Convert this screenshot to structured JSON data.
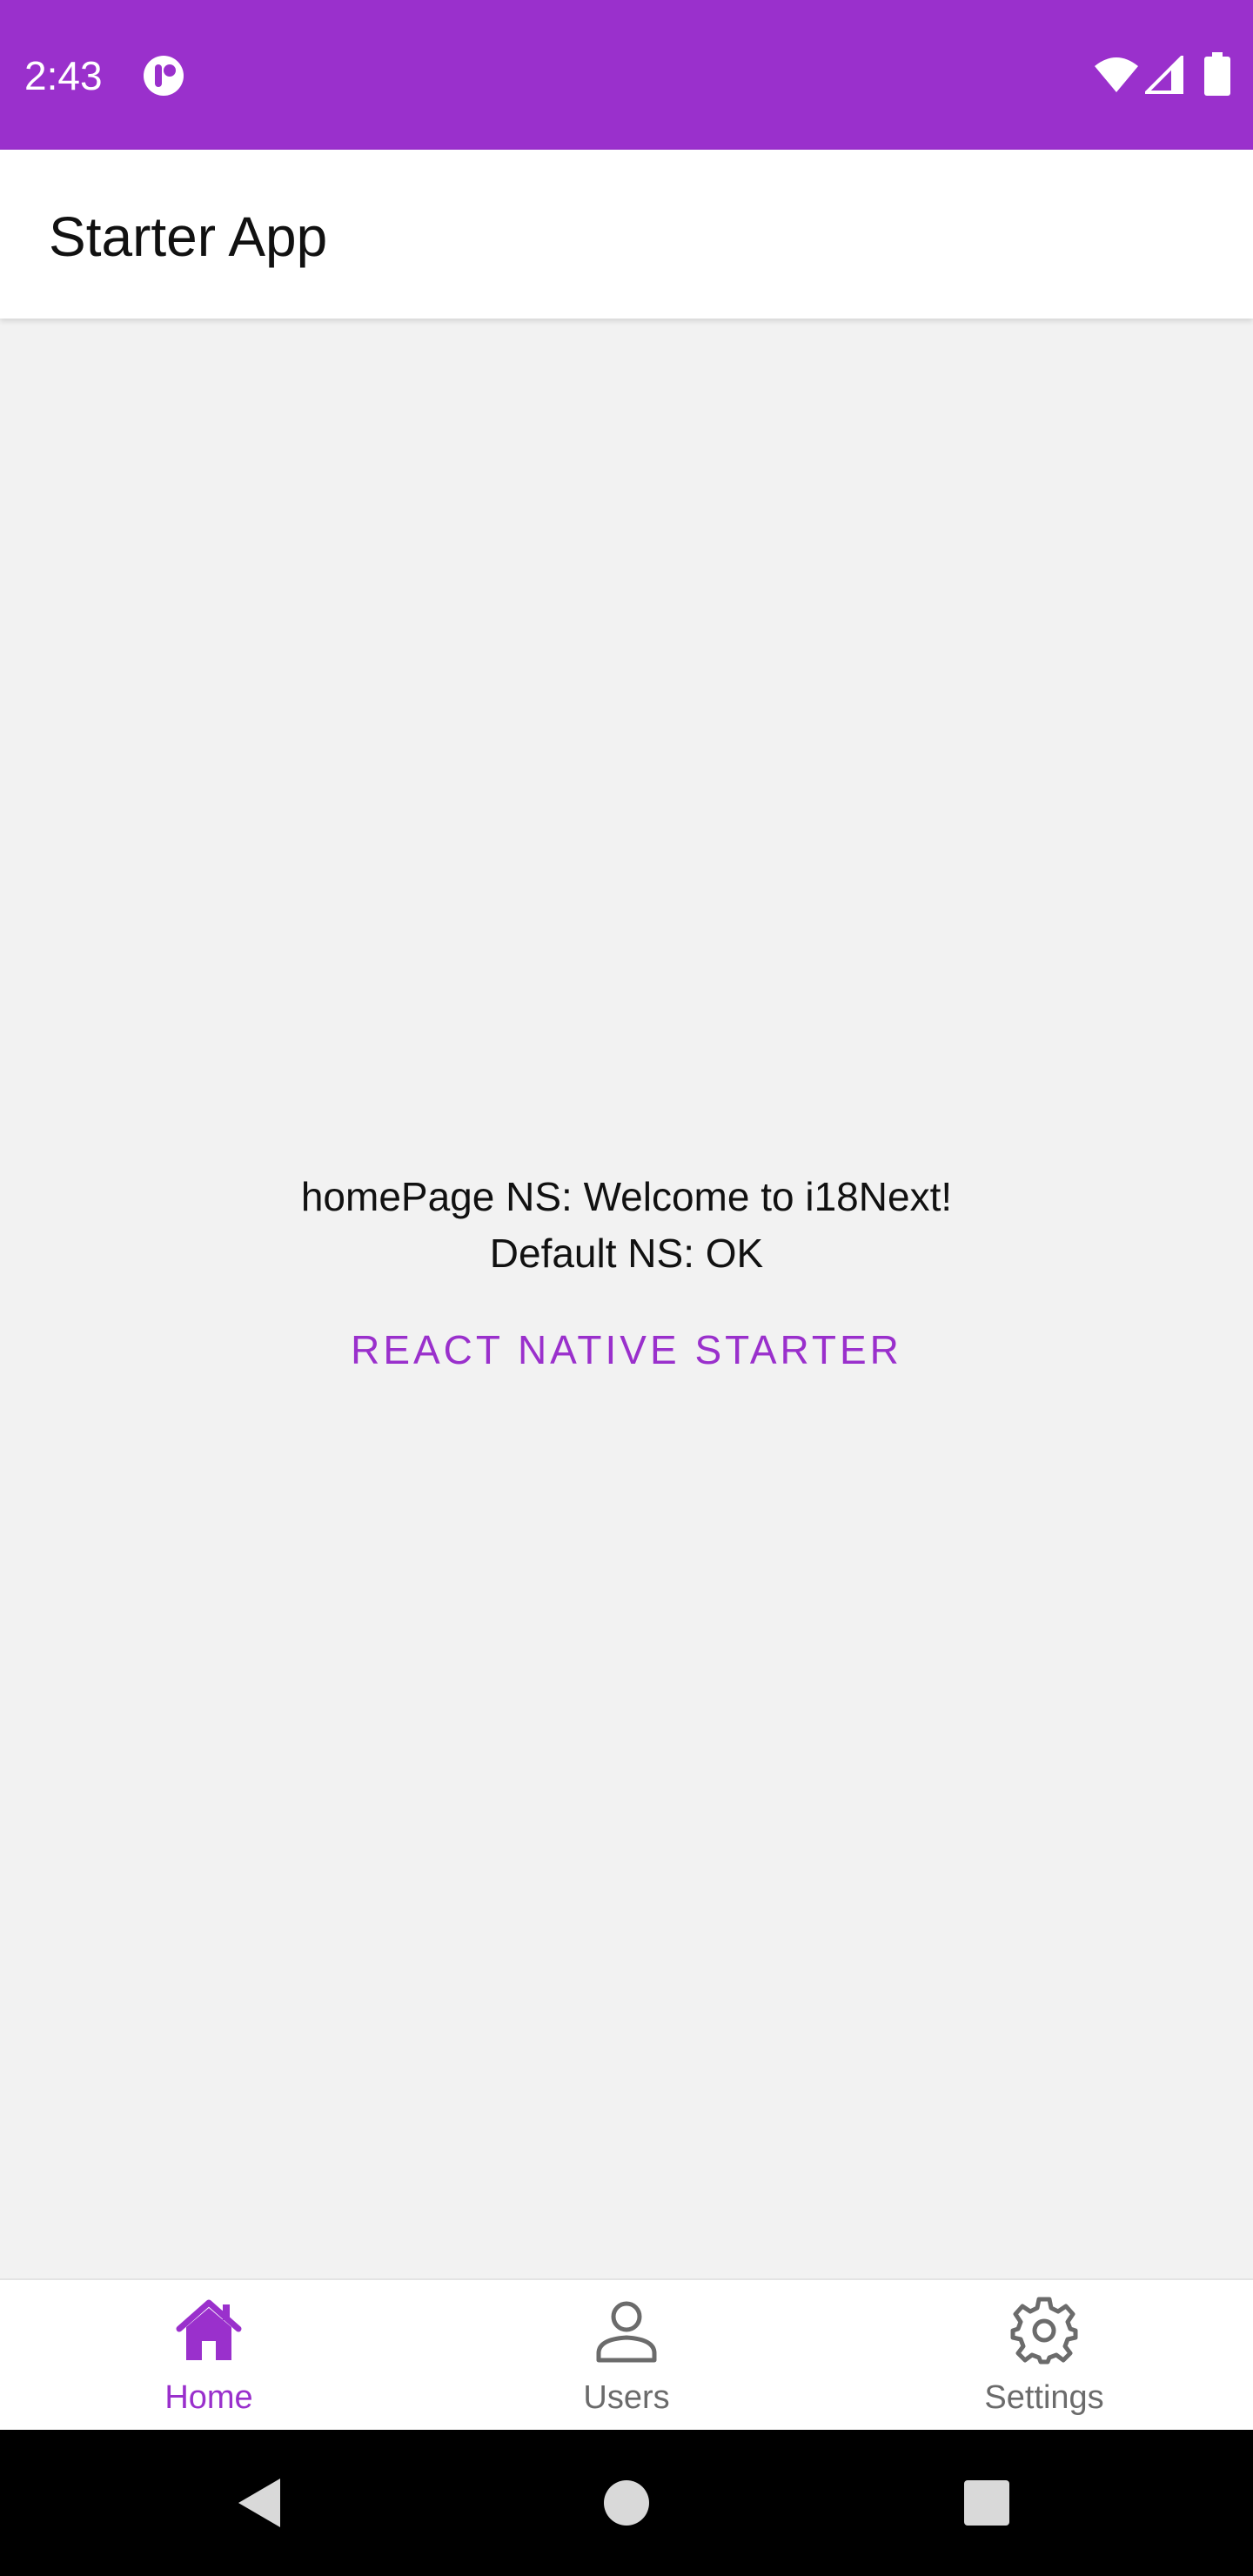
{
  "status_bar": {
    "time": "2:43",
    "app_icon": "notification-app-icon",
    "icons": [
      "wifi-icon",
      "cell-signal-icon",
      "battery-icon"
    ],
    "color": "#9a30cc"
  },
  "app_bar": {
    "title": "Starter App"
  },
  "content": {
    "line1": "homePage NS: Welcome to i18Next!",
    "line2": "Default NS: OK",
    "button_label": "REACT NATIVE STARTER",
    "accent_color": "#9a30cc"
  },
  "tabs": [
    {
      "label": "Home",
      "icon": "home-icon",
      "active": true
    },
    {
      "label": "Users",
      "icon": "user-icon",
      "active": false
    },
    {
      "label": "Settings",
      "icon": "gear-icon",
      "active": false
    }
  ],
  "nav_bar": {
    "buttons": [
      "back-icon",
      "home-circle-icon",
      "recents-icon"
    ]
  }
}
